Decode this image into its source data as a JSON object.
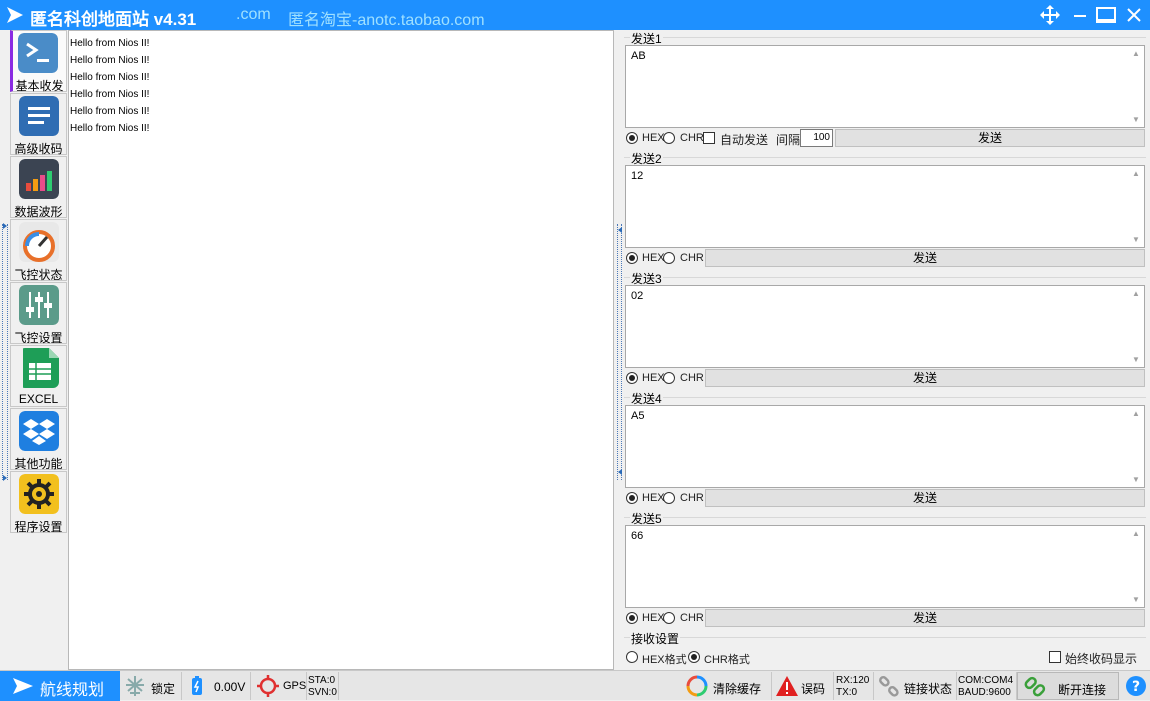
{
  "window": {
    "title": "匿名科创地面站 v4.31",
    "subtitle_left": ".com",
    "subtitle_right": "匿名淘宝-anotc.taobao.com",
    "colors": {
      "titlebar": "#1e90ff",
      "accent_active": "#8a2be2"
    }
  },
  "sidebar": {
    "items": [
      {
        "label": "基本收发",
        "icon": "terminal-icon",
        "color": "#4a8cc8"
      },
      {
        "label": "高级收码",
        "icon": "document-lines-icon",
        "color": "#2f6db3"
      },
      {
        "label": "数据波形",
        "icon": "bar-chart-icon",
        "color": "#3b4452"
      },
      {
        "label": "飞控状态",
        "icon": "gauge-icon",
        "color": "#e8e8e8"
      },
      {
        "label": "飞控设置",
        "icon": "sliders-icon",
        "color": "#5b9b8a"
      },
      {
        "label": "EXCEL",
        "icon": "spreadsheet-icon",
        "color": "#1e9e57"
      },
      {
        "label": "其他功能",
        "icon": "dropbox-icon",
        "color": "#1f7fe0"
      },
      {
        "label": "程序设置",
        "icon": "gear-icon",
        "color": "#f2c01e"
      }
    ]
  },
  "receive": {
    "lines": [
      "Hello from Nios II!",
      "Hello from Nios II!",
      "Hello from Nios II!",
      "Hello from Nios II!",
      "Hello from Nios II!",
      "Hello from Nios II!"
    ]
  },
  "send_groups": [
    {
      "label": "发送1",
      "value": "AB",
      "hex_label": "HEX",
      "chr_label": "CHR",
      "mode": "HEX",
      "button": "发送"
    },
    {
      "label": "发送2",
      "value": "12",
      "hex_label": "HEX",
      "chr_label": "CHR",
      "mode": "HEX",
      "button": "发送"
    },
    {
      "label": "发送3",
      "value": "02",
      "hex_label": "HEX",
      "chr_label": "CHR",
      "mode": "HEX",
      "button": "发送"
    },
    {
      "label": "发送4",
      "value": "A5",
      "hex_label": "HEX",
      "chr_label": "CHR",
      "mode": "HEX",
      "button": "发送"
    },
    {
      "label": "发送5",
      "value": "66",
      "hex_label": "HEX",
      "chr_label": "CHR",
      "mode": "HEX",
      "button": "发送"
    }
  ],
  "auto_send": {
    "label": "自动发送",
    "checked": false,
    "interval_label": "间隔",
    "interval_value": "100"
  },
  "receive_settings": {
    "label": "接收设置",
    "hex_label": "HEX格式",
    "chr_label": "CHR格式",
    "mode": "CHR",
    "always_show_label": "始终收码显示",
    "always_show_checked": false
  },
  "statusbar": {
    "route": "航线规划",
    "lock": "锁定",
    "voltage": "0.00V",
    "gps": "GPS",
    "sta": "STA:0",
    "svn": "SVN:0",
    "clear_cache": "清除缓存",
    "error_code": "误码",
    "rx": "RX:120",
    "tx": "TX:0",
    "link_status": "链接状态",
    "com": "COM:COM4",
    "baud": "BAUD:9600",
    "disconnect": "断开连接"
  }
}
